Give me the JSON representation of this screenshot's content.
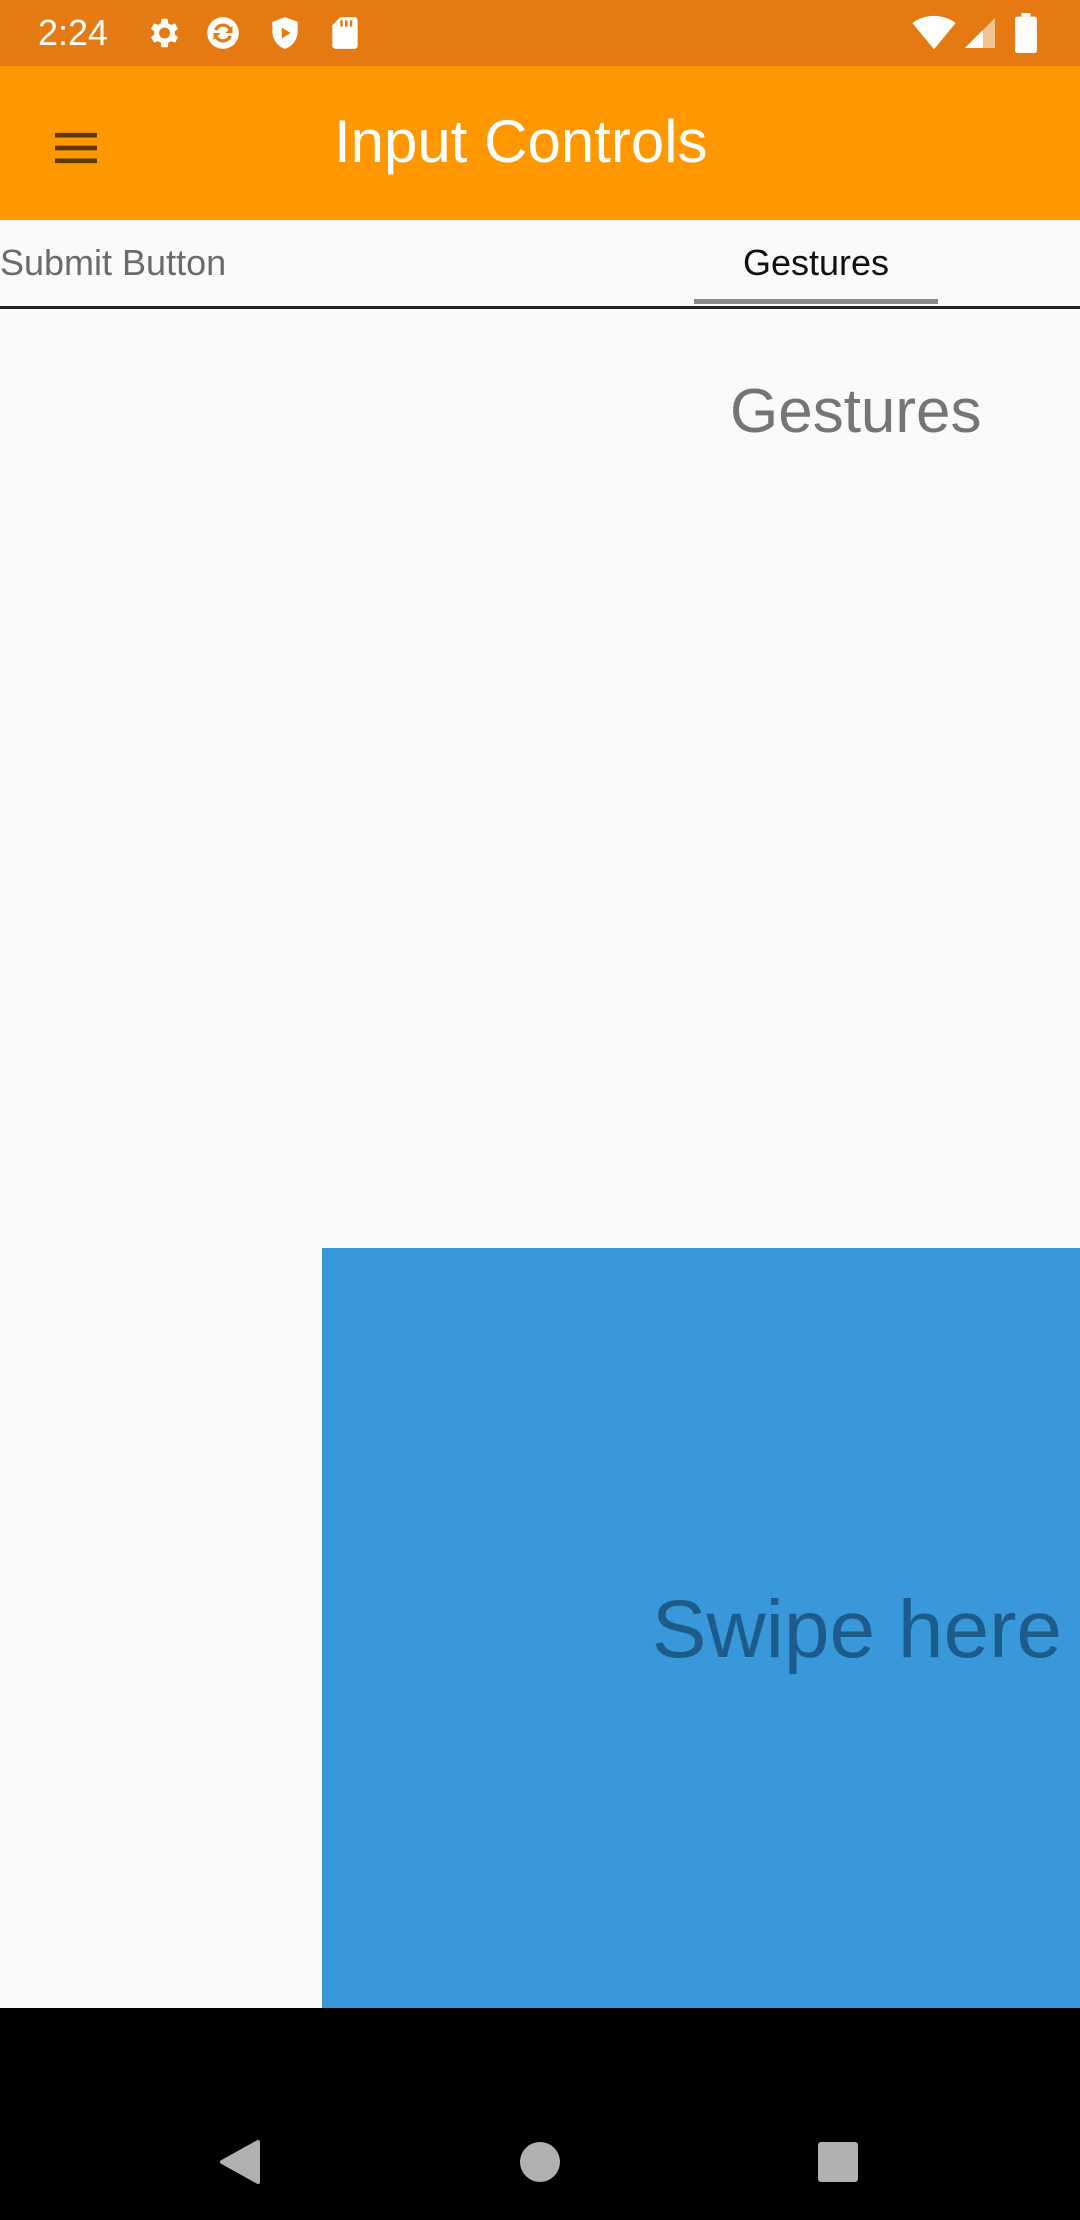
{
  "status_bar": {
    "time": "2:24",
    "background": "#e57a12",
    "left_icons": [
      "settings-icon",
      "sync-icon",
      "shield-play-icon",
      "sd-card-icon"
    ],
    "right_icons": [
      "wifi-icon",
      "cell-signal-icon",
      "battery-icon"
    ]
  },
  "app_bar": {
    "title": "Input Controls",
    "background": "#ff9800",
    "menu_icon": "menu-icon"
  },
  "tabs": {
    "items": [
      {
        "label": "Submit Button",
        "selected": false
      },
      {
        "label": "Gestures",
        "selected": true
      }
    ]
  },
  "content": {
    "section_title": "Gestures",
    "swipe_area": {
      "label": "Swipe here",
      "color": "#3898da"
    }
  },
  "nav_bar": {
    "buttons": [
      "back-icon",
      "home-icon",
      "recents-icon"
    ]
  }
}
